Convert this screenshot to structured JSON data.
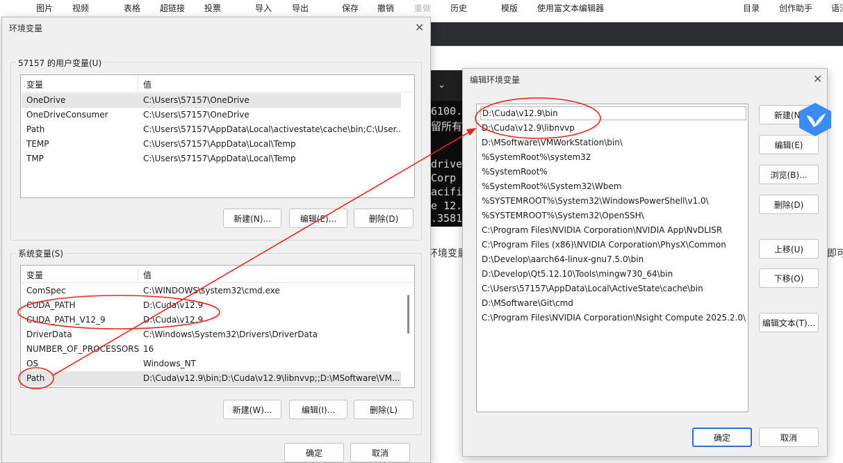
{
  "toolbar": {
    "items": [
      "图片",
      "视频",
      "表格",
      "超链接",
      "投票",
      "导入",
      "导出",
      "保存",
      "撤销",
      "重做",
      "历史",
      "模版",
      "使用富文本编辑器",
      "目录",
      "创作助手",
      "语法"
    ]
  },
  "background": {
    "terminal_lines": [
      "6100.",
      "留所有",
      "drive",
      "Corp",
      "acific",
      "e 12.",
      ".3581"
    ],
    "page_text_left": "环境变量",
    "page_text_right": "即可"
  },
  "env_dialog": {
    "title": "环境变量",
    "user_section": {
      "label": "57157 的用户变量(U)",
      "columns": [
        "变量",
        "值"
      ],
      "rows": [
        {
          "name": "OneDrive",
          "value": "C:\\Users\\57157\\OneDrive"
        },
        {
          "name": "OneDriveConsumer",
          "value": "C:\\Users\\57157\\OneDrive"
        },
        {
          "name": "Path",
          "value": "C:\\Users\\57157\\AppData\\Local\\activestate\\cache\\bin;C:\\User..."
        },
        {
          "name": "TEMP",
          "value": "C:\\Users\\57157\\AppData\\Local\\Temp"
        },
        {
          "name": "TMP",
          "value": "C:\\Users\\57157\\AppData\\Local\\Temp"
        }
      ],
      "buttons": {
        "new": "新建(N)...",
        "edit": "编辑(E)...",
        "delete": "删除(D)"
      }
    },
    "system_section": {
      "label": "系统变量(S)",
      "columns": [
        "变量",
        "值"
      ],
      "rows": [
        {
          "name": "ComSpec",
          "value": "C:\\WINDOWS\\system32\\cmd.exe"
        },
        {
          "name": "CUDA_PATH",
          "value": "D:\\Cuda\\v12.9"
        },
        {
          "name": "CUDA_PATH_V12_9",
          "value": "D:\\Cuda\\v12.9"
        },
        {
          "name": "DriverData",
          "value": "C:\\Windows\\System32\\Drivers\\DriverData"
        },
        {
          "name": "NUMBER_OF_PROCESSORS",
          "value": "16"
        },
        {
          "name": "OS",
          "value": "Windows_NT"
        },
        {
          "name": "Path",
          "value": "D:\\Cuda\\v12.9\\bin;D:\\Cuda\\v12.9\\libnvvp;;D:\\MSoftware\\VM..."
        }
      ],
      "buttons": {
        "new": "新建(W)...",
        "edit": "编辑(I)...",
        "delete": "删除(L)"
      }
    },
    "ok": "确定",
    "cancel": "取消"
  },
  "edit_dialog": {
    "title": "编辑环境变量",
    "entries": [
      "D:\\Cuda\\v12.9\\bin",
      "D:\\Cuda\\v12.9\\libnvvp",
      "D:\\MSoftware\\VMWorkStation\\bin\\",
      "%SystemRoot%\\system32",
      "%SystemRoot%",
      "%SystemRoot%\\System32\\Wbem",
      "%SYSTEMROOT%\\System32\\WindowsPowerShell\\v1.0\\",
      "%SYSTEMROOT%\\System32\\OpenSSH\\",
      "C:\\Program Files\\NVIDIA Corporation\\NVIDIA App\\NvDLISR",
      "C:\\Program Files (x86)\\NVIDIA Corporation\\PhysX\\Common",
      "D:\\Develop\\aarch64-linux-gnu7.5.0\\bin",
      "D:\\Develop\\Qt5.12.10\\Tools\\mingw730_64\\bin",
      "C:\\Users\\57157\\AppData\\Local\\ActiveState\\cache\\bin",
      "D:\\MSoftware\\Git\\cmd",
      "C:\\Program Files\\NVIDIA Corporation\\Nsight Compute 2025.2.0\\"
    ],
    "buttons": {
      "new": "新建(N)",
      "edit": "编辑(E)",
      "browse": "浏览(B)...",
      "delete": "删除(D)",
      "move_up": "上移(U)",
      "move_down": "下移(O)",
      "edit_text": "编辑文本(T)...",
      "ok": "确定",
      "cancel": "取消"
    }
  },
  "colors": {
    "selection": "#0078d7",
    "annotation": "#e8241d",
    "primary_border": "#2c6fd1",
    "assistant_icon": "#3b8cf2"
  },
  "icons": [
    "close-icon",
    "assistant-bird-icon"
  ]
}
